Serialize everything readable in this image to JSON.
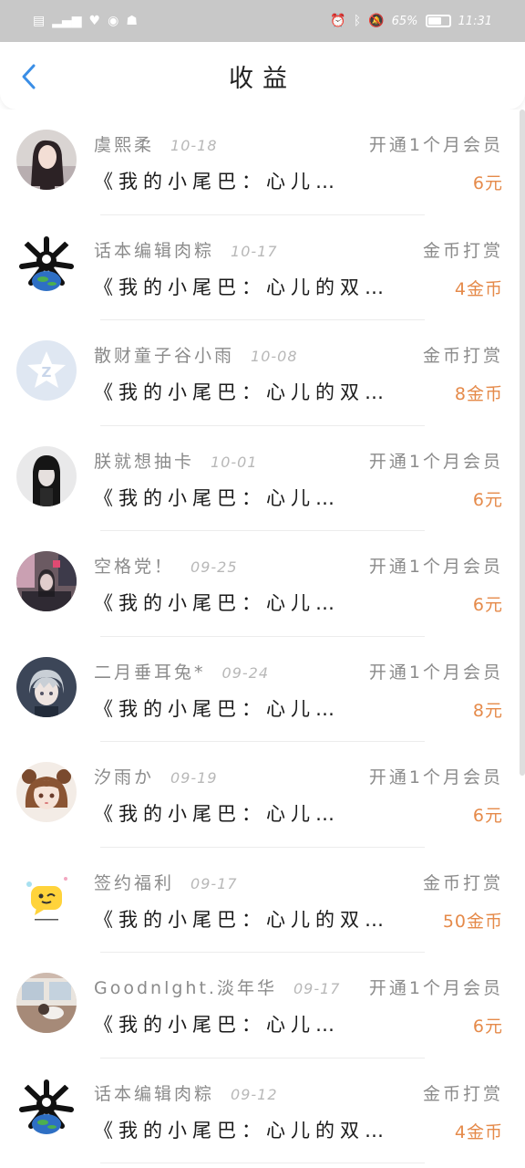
{
  "status_bar": {
    "battery_percent": "65%",
    "battery_level": 0.65,
    "time": "11:31",
    "left_icons": [
      "sim-icon",
      "signal-icon",
      "heart-icon",
      "wechat-icon",
      "app-icon"
    ],
    "right_icons": [
      "alarm-icon",
      "bluetooth-icon",
      "mute-icon"
    ]
  },
  "header": {
    "title": "收益",
    "back_icon": "chevron-left-icon"
  },
  "colors": {
    "accent_blue": "#3a8ee6",
    "amount_orange": "#e58a4a",
    "status_bar_bg": "#c8c8c8"
  },
  "items": [
    {
      "name": "虞熙柔",
      "date": "10-18",
      "type": "开通1个月会员",
      "title": "《我的小尾巴：心儿…",
      "amount": "6元",
      "avatar": "photo-woman-avatar"
    },
    {
      "name": "话本编辑肉粽",
      "date": "10-17",
      "type": "金币打赏",
      "title": "《我的小尾巴：心儿的双…",
      "amount": "4金币",
      "avatar": "earth-monster-avatar"
    },
    {
      "name": "散财童子谷小雨",
      "date": "10-08",
      "type": "金币打赏",
      "title": "《我的小尾巴：心儿的双…",
      "amount": "8金币",
      "avatar": "default-z-avatar"
    },
    {
      "name": "朕就想抽卡",
      "date": "10-01",
      "type": "开通1个月会员",
      "title": "《我的小尾巴：心儿…",
      "amount": "6元",
      "avatar": "dark-girl-avatar"
    },
    {
      "name": "空格党！",
      "date": "09-25",
      "type": "开通1个月会员",
      "title": "《我的小尾巴：心儿…",
      "amount": "6元",
      "avatar": "city-girl-avatar"
    },
    {
      "name": "二月垂耳兔*",
      "date": "09-24",
      "type": "开通1个月会员",
      "title": "《我的小尾巴：心儿…",
      "amount": "8元",
      "avatar": "anime-boy-avatar"
    },
    {
      "name": "汐雨か",
      "date": "09-19",
      "type": "开通1个月会员",
      "title": "《我的小尾巴：心儿…",
      "amount": "6元",
      "avatar": "anime-girl-avatar"
    },
    {
      "name": "签约福利",
      "date": "09-17",
      "type": "金币打赏",
      "title": "《我的小尾巴：心儿的双…",
      "amount": "50金币",
      "avatar": "yellow-chat-avatar"
    },
    {
      "name": "Goodnlght.淡年华",
      "date": "09-17",
      "type": "开通1个月会员",
      "title": "《我的小尾巴：心儿…",
      "amount": "6元",
      "avatar": "window-photo-avatar"
    },
    {
      "name": "话本编辑肉粽",
      "date": "09-12",
      "type": "金币打赏",
      "title": "《我的小尾巴：心儿的双…",
      "amount": "4金币",
      "avatar": "earth-monster-avatar"
    }
  ]
}
